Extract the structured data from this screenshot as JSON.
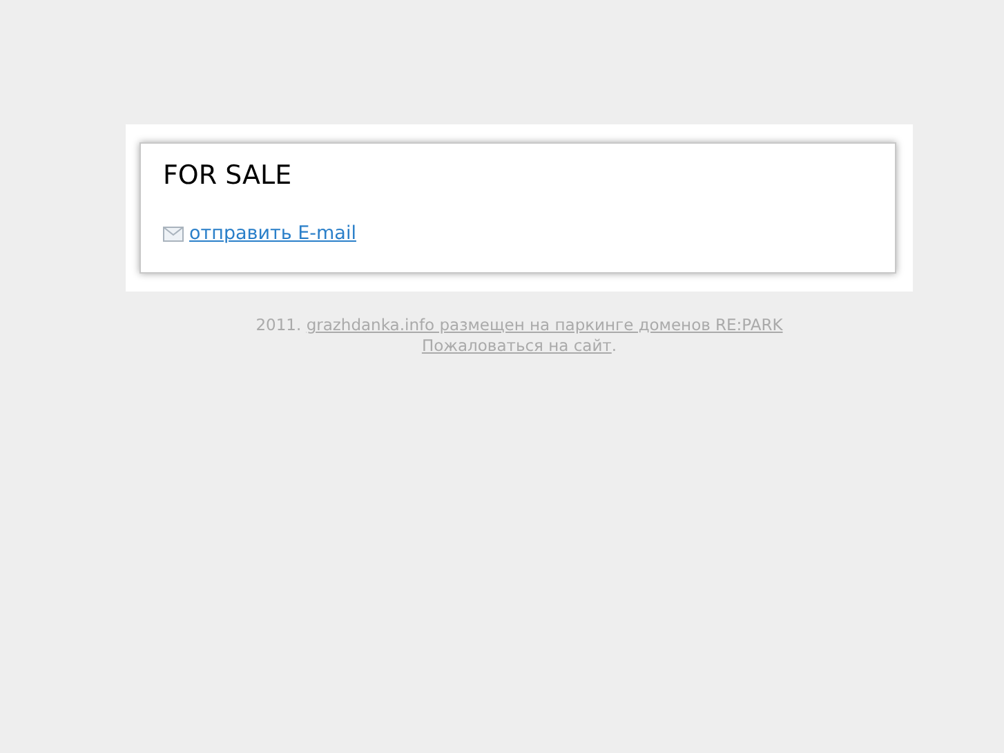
{
  "card": {
    "title": "FOR SALE",
    "email_link": "отправить E-mail"
  },
  "footer": {
    "year": "2011.",
    "parking_link": "grazhdanka.info размещен на паркинге доменов RE:PARK",
    "report_link": "Пожаловаться на сайт",
    "end": "."
  }
}
